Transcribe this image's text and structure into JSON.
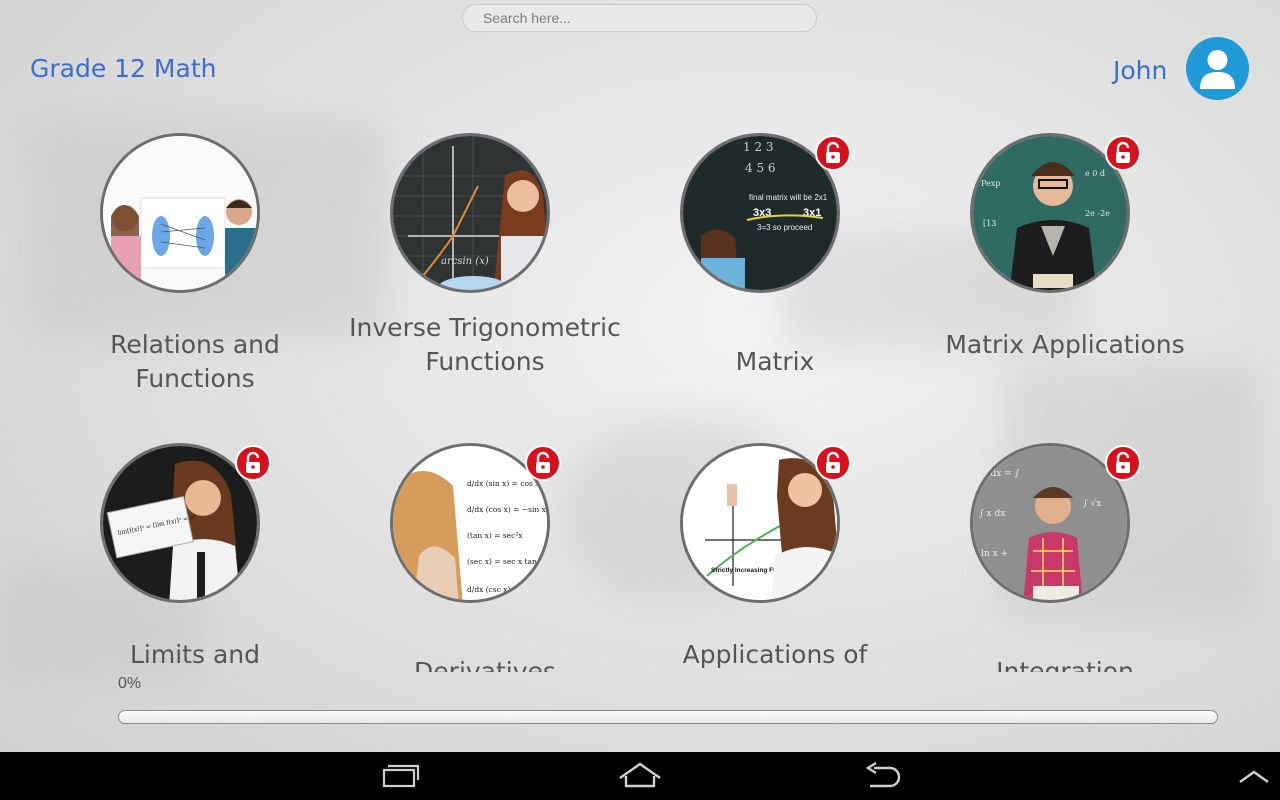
{
  "search": {
    "placeholder": "Search here..."
  },
  "header": {
    "title": "Grade 12 Math",
    "user_name": "John"
  },
  "topics": [
    {
      "label": "Relations and Functions",
      "locked": false
    },
    {
      "label": "Inverse Trigonometric Functions",
      "locked": false
    },
    {
      "label": "Matrix",
      "locked": true
    },
    {
      "label": "Matrix Applications",
      "locked": true
    },
    {
      "label": "Limits and",
      "locked": true
    },
    {
      "label": "Derivatives",
      "locked": true
    },
    {
      "label": "Applications of",
      "locked": true
    },
    {
      "label": "Integration",
      "locked": true
    }
  ],
  "images": {
    "matrix_text1": "final matrix will be 2x1",
    "matrix_dim1": "3x3",
    "matrix_dim2": "3x1",
    "matrix_text2": "3=3 so proceed",
    "inv_trig_text": "arcsin (x)",
    "applications_text": "Strictly Increasing Function"
  },
  "progress": {
    "label": "0%",
    "value": 0
  },
  "colors": {
    "accent": "#3a6fd0",
    "lock": "#d8101c",
    "avatar": "#1f9ad6"
  },
  "navigation": {
    "icons": [
      "recent-apps-icon",
      "home-icon",
      "back-icon",
      "chevron-up-icon"
    ]
  }
}
